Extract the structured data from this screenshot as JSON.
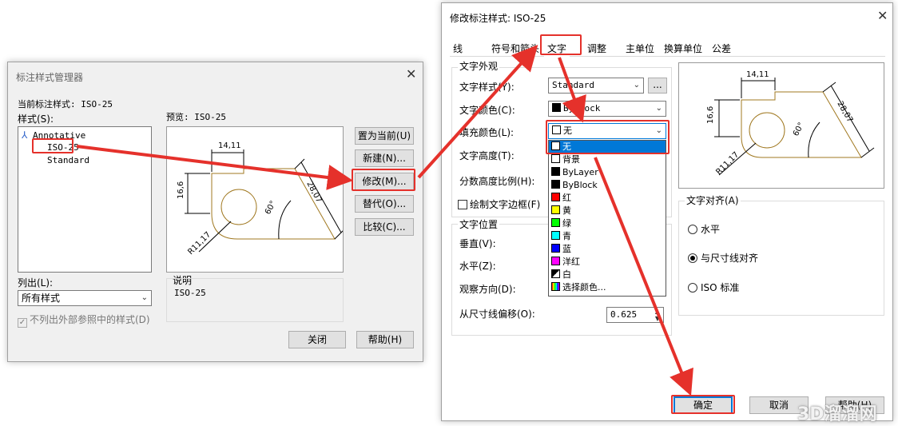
{
  "left_dialog": {
    "title": "标注样式管理器",
    "current_style_label": "当前标注样式: ISO-25",
    "styles_label": "样式(S):",
    "styles": [
      "Annotative",
      "ISO-25",
      "Standard"
    ],
    "preview_label": "预览: ISO-25",
    "list_label": "列出(L):",
    "list_value": "所有样式",
    "xref_checkbox": "不列出外部参照中的样式(D)",
    "description_label": "说明",
    "description_value": "ISO-25",
    "buttons": {
      "set_current": "置为当前(U)",
      "new": "新建(N)...",
      "modify": "修改(M)...",
      "override": "替代(O)...",
      "compare": "比较(C)...",
      "close": "关闭",
      "help": "帮助(H)"
    }
  },
  "preview": {
    "dim_top": "14,11",
    "dim_left": "16,6",
    "dim_diag": "28,07",
    "dim_angle": "60°",
    "dim_radius": "R11,17"
  },
  "right_dialog": {
    "title": "修改标注样式: ISO-25",
    "tabs": [
      "线",
      "符号和箭头",
      "文字",
      "调整",
      "主单位",
      "换算单位",
      "公差"
    ],
    "active_tab": "文字",
    "text_appearance_group": "文字外观",
    "text_style_label": "文字样式(Y):",
    "text_style_value": "Standard",
    "text_color_label": "文字颜色(C):",
    "text_color_value": "ByBlock",
    "fill_color_label": "填充颜色(L):",
    "fill_color_value": "无",
    "text_height_label": "文字高度(T):",
    "fraction_scale_label": "分数高度比例(H):",
    "draw_frame_label": "绘制文字边框(F)",
    "text_position_group": "文字位置",
    "vertical_label": "垂直(V):",
    "horizontal_label": "水平(Z):",
    "view_direction_label": "观察方向(D):",
    "offset_label": "从尺寸线偏移(O):",
    "offset_value": "0.625",
    "alignment_group": "文字对齐(A)",
    "align_options": [
      "水平",
      "与尺寸线对齐",
      "ISO 标准"
    ],
    "align_selected": "与尺寸线对齐",
    "dropdown_items": [
      {
        "label": "无",
        "color": "#ffffff"
      },
      {
        "label": "背景",
        "color": "#ffffff"
      },
      {
        "label": "ByLayer",
        "color": "#000000"
      },
      {
        "label": "ByBlock",
        "color": "#000000"
      },
      {
        "label": "红",
        "color": "#ff0000"
      },
      {
        "label": "黄",
        "color": "#ffff00"
      },
      {
        "label": "绿",
        "color": "#00ff00"
      },
      {
        "label": "青",
        "color": "#00ffff"
      },
      {
        "label": "蓝",
        "color": "#0000ff"
      },
      {
        "label": "洋红",
        "color": "#ff00ff"
      },
      {
        "label": "白",
        "color": "#ffffff"
      },
      {
        "label": "选择颜色...",
        "color": "#888888"
      }
    ],
    "buttons": {
      "ok": "确定",
      "cancel": "取消",
      "help": "帮助(H)"
    }
  },
  "watermark": "3D溜溜网",
  "colors": {
    "highlight": "#0078d7",
    "annotation": "#e5312b",
    "outline": "#a07820"
  }
}
